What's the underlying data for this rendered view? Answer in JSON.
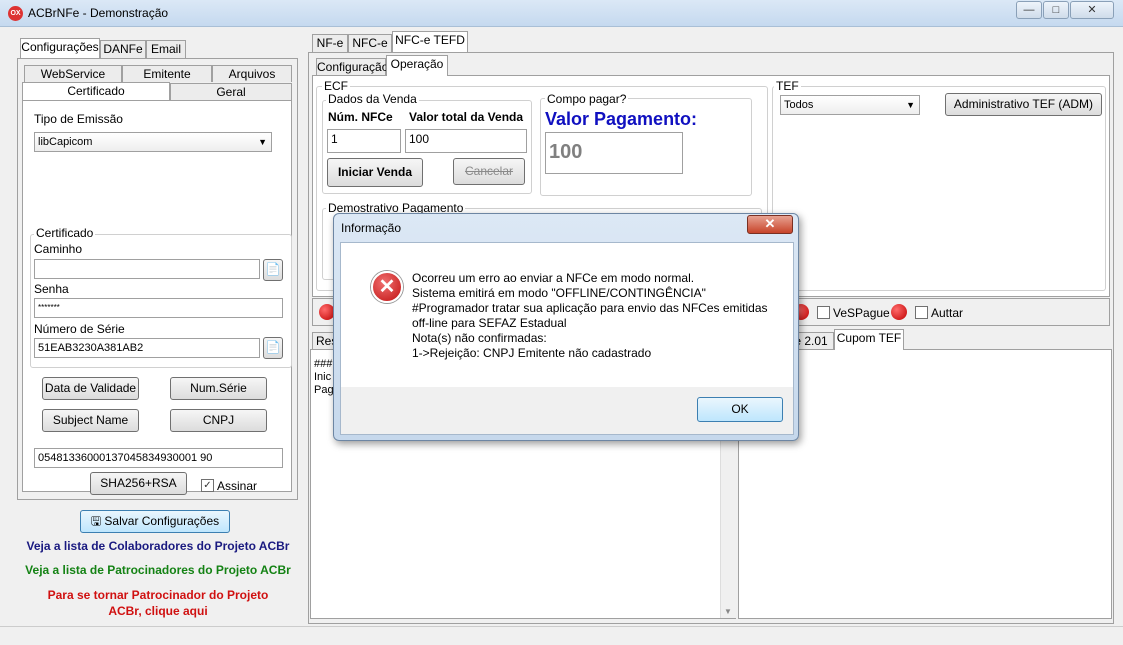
{
  "window": {
    "title": "ACBrNFe - Demonstração",
    "icon_text": "OX",
    "minimize": "—",
    "maximize": "□",
    "close": "✕"
  },
  "left": {
    "tabs": [
      "Configurações",
      "DANFe",
      "Email"
    ],
    "subtabs_row1": [
      "WebService",
      "Emitente",
      "Arquivos"
    ],
    "subtabs_row2": [
      "Certificado",
      "Geral"
    ],
    "tipo_emissao_label": "Tipo de Emissão",
    "tipo_emissao_value": "libCapicom",
    "certificado_legend": "Certificado",
    "caminho_label": "Caminho",
    "caminho_value": "",
    "senha_label": "Senha",
    "senha_value": "*******",
    "numero_serie_label": "Número de Série",
    "numero_serie_value": "51EAB3230A381AB2",
    "btn_data_validade": "Data de Validade",
    "btn_num_serie": "Num.Série",
    "btn_subject": "Subject Name",
    "btn_cnpj": "CNPJ",
    "hash_value": "05481336000137045834930001 90",
    "btn_sha": "SHA256+RSA",
    "assinar_label": "Assinar",
    "btn_salvar": "Salvar Configurações",
    "link_colab": "Veja a lista de Colaboradores do Projeto ACBr",
    "link_patro": "Veja a lista de Patrocinadores do Projeto ACBr",
    "link_tornar": "Para se tornar Patrocinador do Projeto ACBr, clique aqui"
  },
  "right": {
    "tabs": [
      "NF-e",
      "NFC-e",
      "NFC-e TEFD"
    ],
    "subtabs": [
      "Configuração",
      "Operação"
    ],
    "ecf_legend": "ECF",
    "dados_venda_legend": "Dados da Venda",
    "num_nfce_label": "Núm. NFCe",
    "valor_total_label": "Valor total da Venda",
    "num_nfce_value": "1",
    "valor_total_value": "100",
    "btn_iniciar": "Iniciar Venda",
    "btn_cancelar": "Cancelar",
    "como_pagar_legend": "Compo pagar?",
    "valor_pagamento_label": "Valor Pagamento:",
    "valor_pagamento_value": "100",
    "demonstrativo_legend": "Demostrativo Pagamento",
    "tef_legend": "TEF",
    "tef_select": "Todos",
    "btn_adm_tef": "Administrativo TEF (ADM)",
    "vespague_label": "VeSPague",
    "auttar_label": "Auttar",
    "bottom_tab_left": "Res",
    "bottom_tabs_right": [
      "e 2.01",
      "Cupom TEF"
    ],
    "log_lines": [
      "###",
      "Inic",
      "Pag"
    ]
  },
  "dialog": {
    "title": "Informação",
    "close": "✕",
    "icon": "✕",
    "message": "Ocorreu um erro ao enviar a NFCe em modo normal.\nSistema emitirá em modo \"OFFLINE/CONTINGÊNCIA\"\n#Programador tratar sua aplicação para envio das NFCes emitidas\noff-line para SEFAZ Estadual\nNota(s) não confirmadas:\n1->Rejeição: CNPJ Emitente não cadastrado",
    "ok": "OK"
  },
  "colors": {
    "link_colab": "#1a1a80",
    "link_patro": "#148214",
    "link_tornar": "#d01010",
    "valor_pagamento": "#1010c0",
    "led": "#d00000"
  }
}
